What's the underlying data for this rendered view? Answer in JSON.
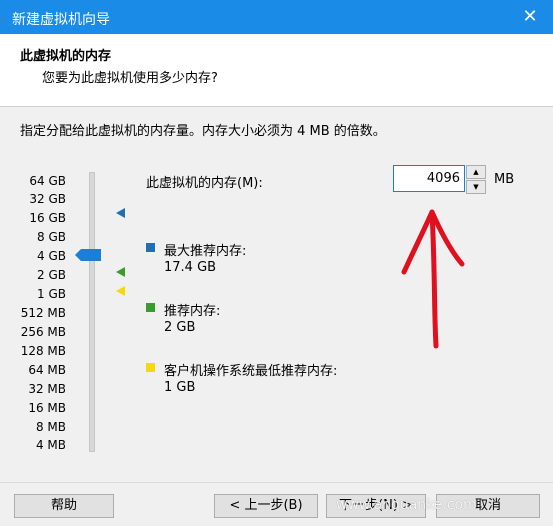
{
  "window": {
    "title": "新建虚拟机向导",
    "close_glyph": "✕"
  },
  "header": {
    "title": "此虚拟机的内存",
    "subtitle": "您要为此虚拟机使用多少内存?"
  },
  "instruction": "指定分配给此虚拟机的内存量。内存大小必须为 4 MB 的倍数。",
  "scale": {
    "labels": [
      "64 GB",
      "32 GB",
      "16 GB",
      "8 GB",
      "4 GB",
      "2 GB",
      "1 GB",
      "512 MB",
      "256 MB",
      "128 MB",
      "64 MB",
      "32 MB",
      "16 MB",
      "8 MB",
      "4 MB"
    ],
    "selected": "4 GB"
  },
  "memory": {
    "label": "此虚拟机的内存(M):",
    "value": "4096",
    "unit": "MB"
  },
  "legend": [
    {
      "label": "最大推荐内存:",
      "value": "17.4 GB",
      "color": "#1f6fb5"
    },
    {
      "label": "推荐内存:",
      "value": "2 GB",
      "color": "#3a9b2e"
    },
    {
      "label": "客户机操作系统最低推荐内存:",
      "value": "1 GB",
      "color": "#f5d90f"
    }
  ],
  "buttons": {
    "help": "帮助",
    "back": "< 上一步(B)",
    "next": "下一步(N) >",
    "cancel": "取消"
  },
  "watermark": "www.anquanke.com",
  "annotation": {
    "color": "#e0101e",
    "icon": "red-up-arrow-icon"
  }
}
